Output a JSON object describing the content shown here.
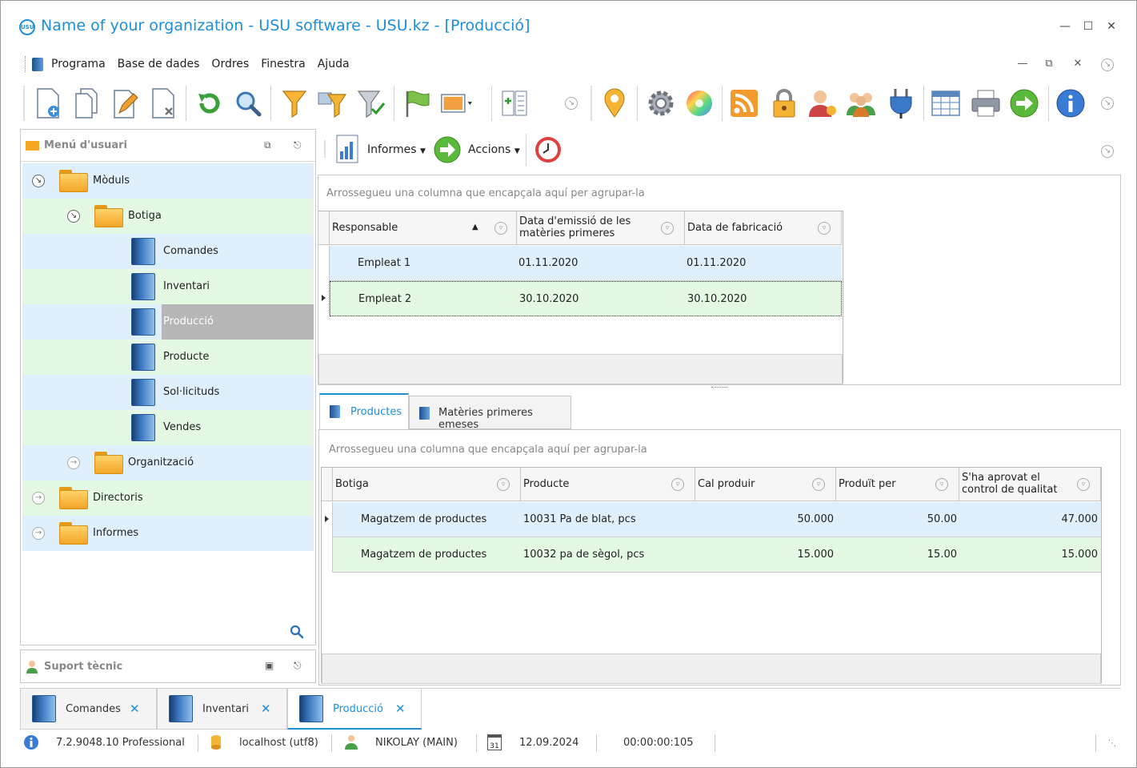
{
  "window": {
    "title": "Name of your organization - USU software - USU.kz - [Producció]",
    "logo_text": "USU",
    "accent_color": "#1e8fd6"
  },
  "menu": {
    "items": [
      "Programa",
      "Base de dades",
      "Ordres",
      "Finestra",
      "Ajuda"
    ]
  },
  "toolbar": {
    "icons": [
      "new-document-icon",
      "copy-icon",
      "edit-icon",
      "delete-icon",
      "refresh-icon",
      "search-icon",
      "filter-icon",
      "filter-edit-icon",
      "filter-clear-icon",
      "flag-icon",
      "image-icon",
      "insert-icon",
      "location-pin-icon",
      "settings-gear-icon",
      "color-wheel-icon",
      "rss-icon",
      "lock-icon",
      "user-admin-icon",
      "users-group-icon",
      "plugin-icon",
      "table-icon",
      "print-icon",
      "next-arrow-icon",
      "info-icon"
    ]
  },
  "left_panel": {
    "title": "Menú d'usuari",
    "tree": {
      "moduls": "Mòduls",
      "botiga": "Botiga",
      "items": [
        "Comandes",
        "Inventari",
        "Producció",
        "Producte",
        "Sol·licituds",
        "Vendes"
      ],
      "organitzacio": "Organització",
      "directoris": "Directoris",
      "informes": "Informes"
    }
  },
  "support_panel": {
    "title": "Suport tècnic"
  },
  "right_toolbar": {
    "informes_label": "Informes",
    "accions_label": "Accions"
  },
  "top_grid": {
    "group_hint": "Arrossegueu una columna que encapçala aquí per agrupar-la",
    "columns": [
      "Responsable",
      "Data d'emissió de les matèries primeres",
      "Data de fabricació"
    ],
    "rows": [
      [
        "Empleat 1",
        "01.11.2020",
        "01.11.2020"
      ],
      [
        "Empleat 2",
        "30.10.2020",
        "30.10.2020"
      ]
    ]
  },
  "detail_tabs": {
    "tab1": "Productes",
    "tab2": "Matèries primeres emeses"
  },
  "bottom_grid": {
    "group_hint": "Arrossegueu una columna que encapçala aquí per agrupar-la",
    "columns": [
      "Botiga",
      "Producte",
      "Cal produir",
      "Produït per",
      "S'ha aprovat el control de qualitat"
    ],
    "rows": [
      [
        "Magatzem de productes",
        "10031 Pa de blat, pcs",
        "50.000",
        "50.00",
        "47.000"
      ],
      [
        "Magatzem de productes",
        "10032 pa de sègol, pcs",
        "15.000",
        "15.00",
        "15.000"
      ]
    ]
  },
  "window_tabs": [
    "Comandes",
    "Inventari",
    "Producció"
  ],
  "statusbar": {
    "version": "7.2.9048.10 Professional",
    "server": "localhost (utf8)",
    "user": "NIKOLAY (MAIN)",
    "calendar_day": "31",
    "date": "12.09.2024",
    "timer": "00:00:00:105"
  }
}
